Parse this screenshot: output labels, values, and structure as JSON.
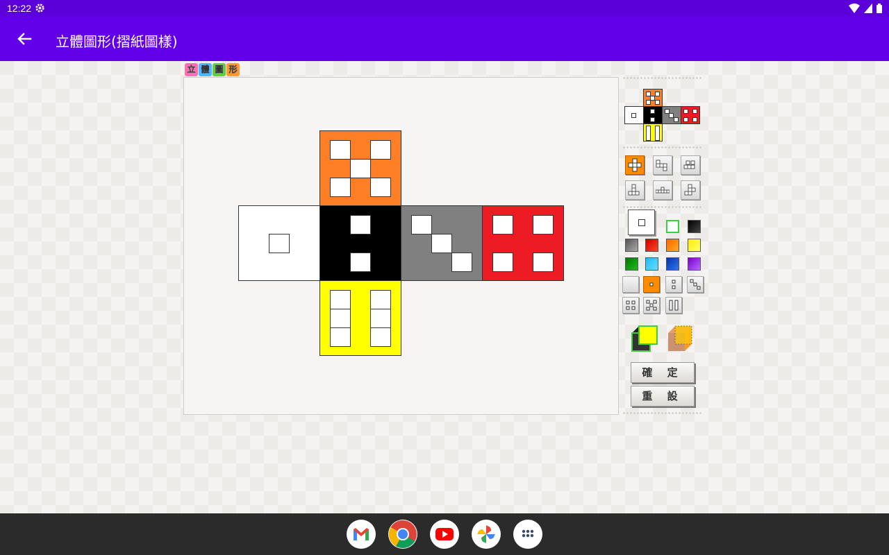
{
  "status": {
    "time": "12:22"
  },
  "appbar": {
    "title": "立體圖形(摺紙圖樣)"
  },
  "logo": {
    "chars": [
      "立",
      "體",
      "圖",
      "形"
    ]
  },
  "net": {
    "faces": [
      {
        "id": "top",
        "color": "#ff7f27",
        "pattern": "five"
      },
      {
        "id": "left",
        "color": "#ffffff",
        "pattern": "one"
      },
      {
        "id": "center",
        "color": "#000000",
        "pattern": "two"
      },
      {
        "id": "right1",
        "color": "#808080",
        "pattern": "three"
      },
      {
        "id": "right2",
        "color": "#ed1c24",
        "pattern": "four"
      },
      {
        "id": "bottom",
        "color": "#ffff00",
        "pattern": "six"
      }
    ]
  },
  "palette": {
    "colors": [
      "#000000",
      "#808080",
      "#ff0000",
      "#ff7f00",
      "#ffff00",
      "#00a000",
      "#33ccff",
      "#0044cc",
      "#9933ff",
      "#e0e0e0"
    ]
  },
  "buttons": {
    "confirm": "確 定",
    "reset": "重 設"
  },
  "dock": {
    "apps": [
      "Gmail",
      "Chrome",
      "YouTube",
      "Photos",
      "App drawer"
    ]
  }
}
